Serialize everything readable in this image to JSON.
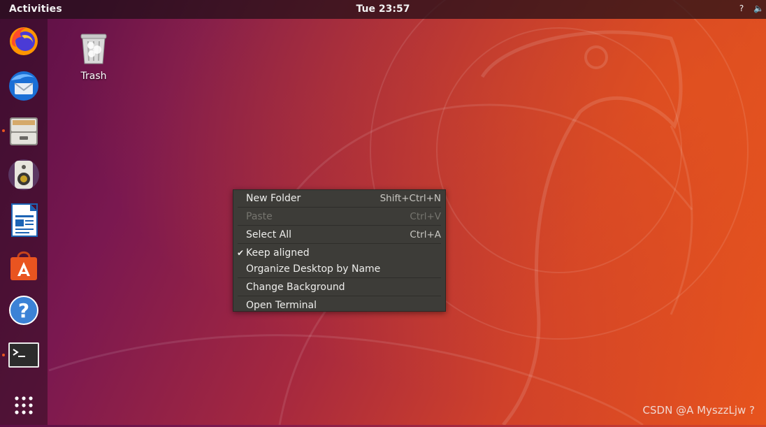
{
  "topbar": {
    "activities_label": "Activities",
    "clock": "Tue 23:57",
    "tray_icons": [
      "network-question-icon",
      "volume-icon"
    ],
    "tray_network_glyph": "?",
    "tray_volume_glyph": "🔈"
  },
  "dock": {
    "items": [
      {
        "name": "firefox",
        "icon": "firefox-icon",
        "running": false
      },
      {
        "name": "thunderbird",
        "icon": "thunderbird-icon",
        "running": false
      },
      {
        "name": "files",
        "icon": "file-cabinet-icon",
        "running": true
      },
      {
        "name": "rhythmbox",
        "icon": "speaker-icon",
        "running": false
      },
      {
        "name": "libreoffice-writer",
        "icon": "writer-document-icon",
        "running": false
      },
      {
        "name": "ubuntu-software",
        "icon": "shopping-bag-icon",
        "running": false
      },
      {
        "name": "help",
        "icon": "help-icon",
        "running": false
      },
      {
        "name": "terminal",
        "icon": "terminal-icon",
        "running": true
      },
      {
        "name": "show-applications",
        "icon": "app-grid-icon",
        "running": false
      }
    ]
  },
  "desktop": {
    "trash_label": "Trash"
  },
  "context_menu": {
    "items": [
      {
        "label": "New Folder",
        "accel": "Shift+Ctrl+N",
        "enabled": true
      },
      {
        "label": "Paste",
        "accel": "Ctrl+V",
        "enabled": false
      },
      {
        "label": "Select All",
        "accel": "Ctrl+A",
        "enabled": true
      },
      {
        "label": "Keep aligned",
        "accel": "",
        "enabled": true,
        "checked": true
      },
      {
        "label": "Organize Desktop by Name",
        "accel": "",
        "enabled": true
      },
      {
        "label": "Change Background",
        "accel": "",
        "enabled": true
      },
      {
        "label": "Open Terminal",
        "accel": "",
        "enabled": true
      }
    ],
    "check_glyph": "✔"
  },
  "watermark": "CSDN @A MyszzLjw ?",
  "colors": {
    "accent": "#e95420",
    "menu_bg": "#3d3c38",
    "menu_text": "#eeeeec",
    "menu_disabled": "#76756f"
  }
}
